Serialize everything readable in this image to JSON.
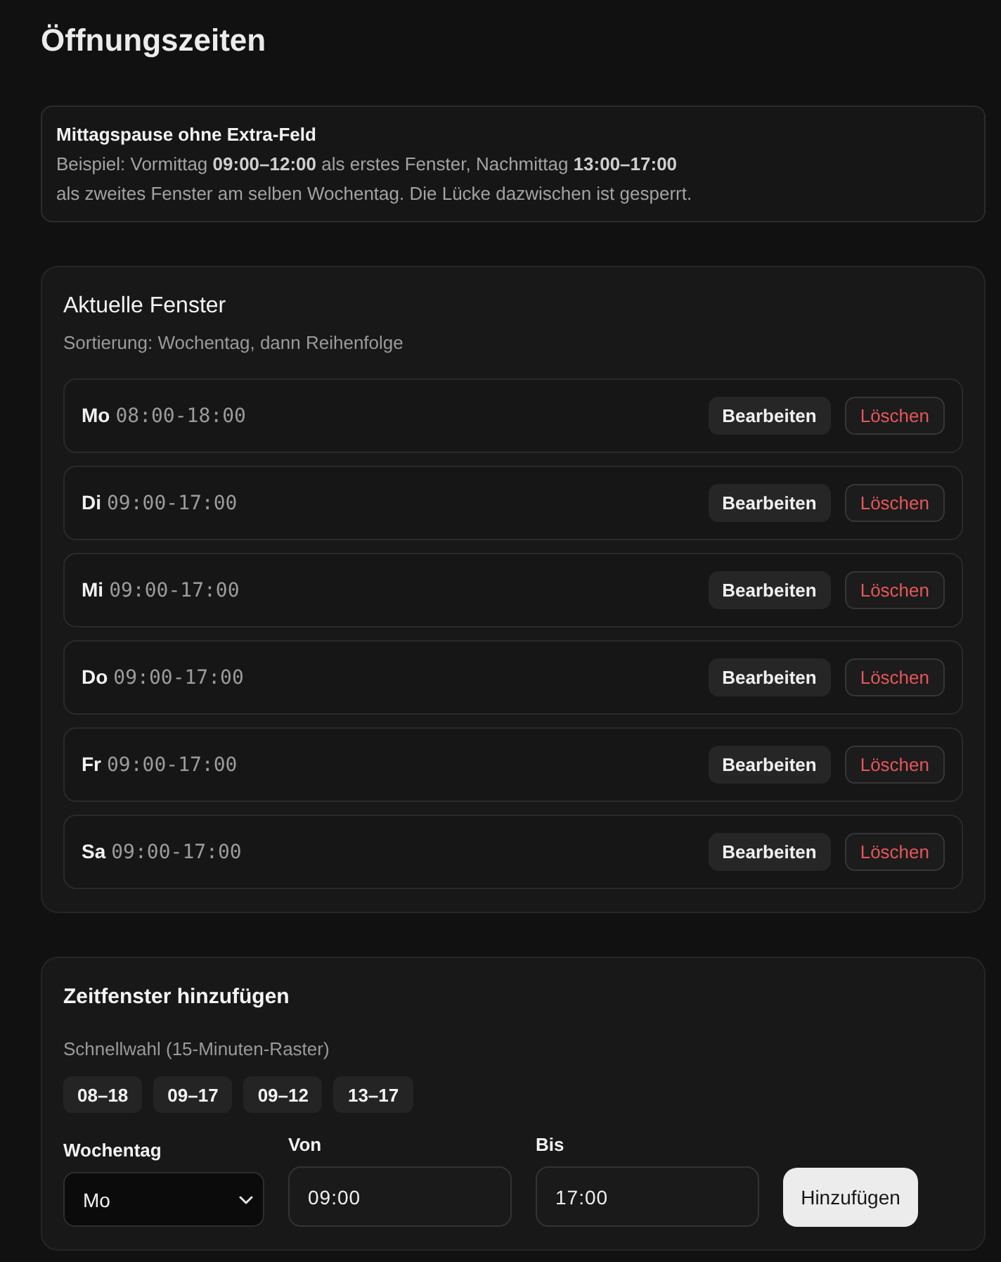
{
  "page": {
    "title": "Öffnungszeiten"
  },
  "info": {
    "title": "Mittagspause ohne Extra-Feld",
    "text": "Beispiel: Vormittag **09:00–12:00** als erstes Fenster, Nachmittag **13:00–17:00**\nals zweites Fenster am selben Wochentag. Die Lücke dazwischen ist gesperrt."
  },
  "windows": {
    "title": "Aktuelle Fenster",
    "subtitle": "Sortierung: Wochentag, dann Reihenfolge",
    "rows": [
      {
        "day": "Mo",
        "time": "08:00-18:00",
        "edit_label": "Bearbeiten",
        "delete_label": "Löschen"
      },
      {
        "day": "Di",
        "time": "09:00-17:00",
        "edit_label": "Bearbeiten",
        "delete_label": "Löschen"
      },
      {
        "day": "Mi",
        "time": "09:00-17:00",
        "edit_label": "Bearbeiten",
        "delete_label": "Löschen"
      },
      {
        "day": "Do",
        "time": "09:00-17:00",
        "edit_label": "Bearbeiten",
        "delete_label": "Löschen"
      },
      {
        "day": "Fr",
        "time": "09:00-17:00",
        "edit_label": "Bearbeiten",
        "delete_label": "Löschen"
      },
      {
        "day": "Sa",
        "time": "09:00-17:00",
        "edit_label": "Bearbeiten",
        "delete_label": "Löschen"
      }
    ]
  },
  "add_form": {
    "title": "Zeitfenster hinzufügen",
    "quick_label": "Schnellwahl (15-Minuten-Raster)",
    "presets": [
      "08–18",
      "09–17",
      "09–12",
      "13–17"
    ],
    "weekday": {
      "label": "Wochentag",
      "value": "Mo"
    },
    "from": {
      "label": "Von",
      "value": "09:00"
    },
    "to": {
      "label": "Bis",
      "value": "17:00"
    },
    "submit": "Hinzufügen"
  }
}
